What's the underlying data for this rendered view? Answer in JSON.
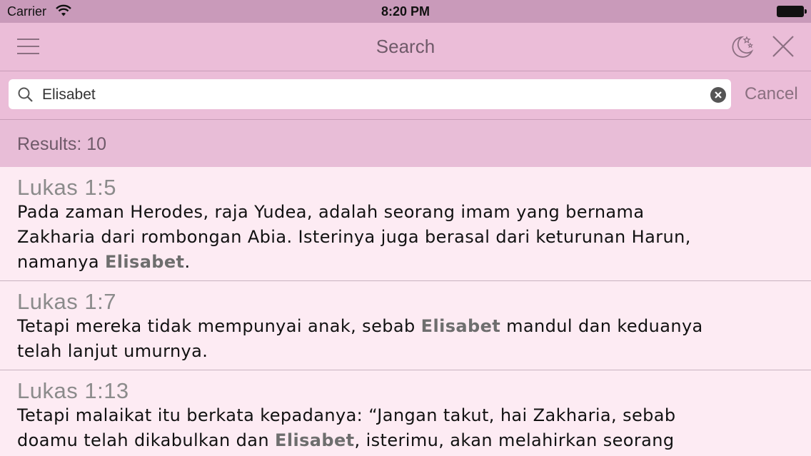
{
  "status_bar": {
    "carrier": "Carrier",
    "time": "8:20 PM"
  },
  "nav": {
    "title": "Search",
    "icons": [
      "menu-icon",
      "night-mode-icon",
      "close-icon"
    ]
  },
  "search": {
    "query": "Elisabet",
    "cancel_label": "Cancel"
  },
  "results_label": "Results: 10",
  "results": [
    {
      "ref": "Lukas 1:5",
      "lines": [
        [
          "Pada zaman Herodes, raja Yudea, adalah seorang imam yang bernama"
        ],
        [
          "Zakharia dari rombongan Abia. Isterinya juga berasal dari keturunan Harun,"
        ],
        [
          "namanya ",
          "Elisabet",
          "."
        ]
      ]
    },
    {
      "ref": "Lukas 1:7",
      "lines": [
        [
          "Tetapi mereka tidak mempunyai anak, sebab ",
          "Elisabet",
          " mandul dan keduanya"
        ],
        [
          "telah lanjut umurnya."
        ]
      ]
    },
    {
      "ref": "Lukas 1:13",
      "lines": [
        [
          "Tetapi malaikat itu berkata kepadanya: “Jangan takut, hai Zakharia, sebab"
        ],
        [
          "doamu telah dikabulkan dan ",
          "Elisabet",
          ", isterimu, akan melahirkan seorang"
        ]
      ]
    }
  ],
  "colors": {
    "status_bar": "#c99aba",
    "nav_bar": "#ebbdd8",
    "list_background": "#fdebf3",
    "highlight": "#6e6e6e"
  }
}
